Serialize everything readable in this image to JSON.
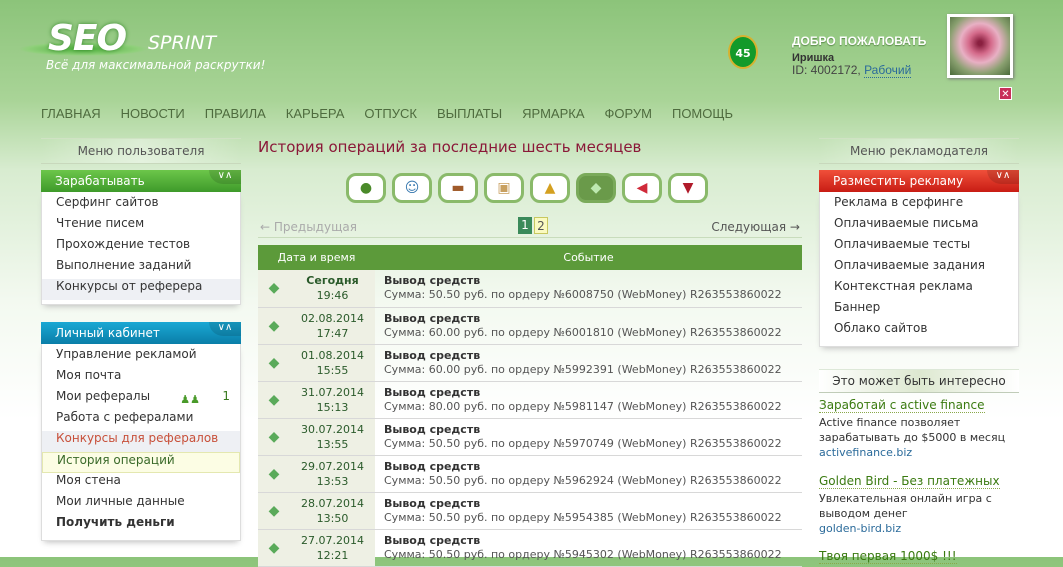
{
  "header": {
    "logo_main": "SEO",
    "logo_sub": "SPRINT",
    "slogan": "Всё для максимальной раскрутки!",
    "level": "45",
    "welcome": "ДОБРО ПОЖАЛОВАТЬ",
    "username": "Иришка",
    "id_label": "ID: 4002172,",
    "status": "Рабочий",
    "close": "✕"
  },
  "nav": [
    "ГЛАВНАЯ",
    "НОВОСТИ",
    "ПРАВИЛА",
    "КАРЬЕРА",
    "ОТПУСК",
    "ВЫПЛАТЫ",
    "ЯРМАРКА",
    "ФОРУМ",
    "ПОМОЩЬ"
  ],
  "left": {
    "title": "Меню пользователя",
    "earn": {
      "header": "Зарабатывать",
      "items": [
        "Серфинг сайтов",
        "Чтение писем",
        "Прохождение тестов",
        "Выполнение заданий",
        "Конкурсы от реферера"
      ]
    },
    "cabinet": {
      "header": "Личный кабинет",
      "items": [
        "Управление рекламой",
        "Моя почта",
        "Мои рефералы",
        "Работа с рефералами",
        "Конкурсы для рефералов",
        "История операций",
        "Моя стена",
        "Мои личные данные",
        "Получить деньги"
      ],
      "referrals_count": "1"
    }
  },
  "main": {
    "title": "История операций за последние шесть месяцев",
    "tabs": [
      "globe-icon",
      "user-icon",
      "wallet-icon",
      "shopping-bag-icon",
      "lock-edit-icon",
      "money-icon",
      "megaphone-icon",
      "wine-glass-icon"
    ],
    "pager": {
      "prev": "← Предыдущая",
      "next": "Следующая →",
      "pages": [
        "1",
        "2"
      ]
    },
    "columns": [
      "Дата и время",
      "Событие"
    ],
    "rows": [
      {
        "date": "Сегодня",
        "time": "19:46",
        "event": "Вывод средств",
        "details": "Сумма: 50.50 руб. по ордеру №6008750 (WebMoney) R263553860022"
      },
      {
        "date": "02.08.2014",
        "time": "17:47",
        "event": "Вывод средств",
        "details": "Сумма: 60.00 руб. по ордеру №6001810 (WebMoney) R263553860022"
      },
      {
        "date": "01.08.2014",
        "time": "15:55",
        "event": "Вывод средств",
        "details": "Сумма: 60.00 руб. по ордеру №5992391 (WebMoney) R263553860022"
      },
      {
        "date": "31.07.2014",
        "time": "15:13",
        "event": "Вывод средств",
        "details": "Сумма: 80.00 руб. по ордеру №5981147 (WebMoney) R263553860022"
      },
      {
        "date": "30.07.2014",
        "time": "13:55",
        "event": "Вывод средств",
        "details": "Сумма: 50.50 руб. по ордеру №5970749 (WebMoney) R263553860022"
      },
      {
        "date": "29.07.2014",
        "time": "13:53",
        "event": "Вывод средств",
        "details": "Сумма: 50.50 руб. по ордеру №5962924 (WebMoney) R263553860022"
      },
      {
        "date": "28.07.2014",
        "time": "13:50",
        "event": "Вывод средств",
        "details": "Сумма: 50.50 руб. по ордеру №5954385 (WebMoney) R263553860022"
      },
      {
        "date": "27.07.2014",
        "time": "12:21",
        "event": "Вывод средств",
        "details": "Сумма: 50.50 руб. по ордеру №5945302 (WebMoney) R263553860022"
      }
    ]
  },
  "right": {
    "title": "Меню рекламодателя",
    "advert": {
      "header": "Разместить рекламу",
      "items": [
        "Реклама в серфинге",
        "Оплачиваемые письма",
        "Оплачиваемые тесты",
        "Оплачиваемые задания",
        "Контекстная реклама",
        "Баннер",
        "Облако сайтов"
      ]
    },
    "interest_title": "Это может быть интересно",
    "ads": [
      {
        "title": "Заработай с active finance",
        "desc": "Active finance позволяет зарабатывать до $5000 в месяц",
        "url": "activefinance.biz"
      },
      {
        "title": "Golden Bird - Без платежных",
        "desc": "Увлекательная онлайн игра с выводом денег",
        "url": "golden-bird.biz"
      },
      {
        "title": "Твоя первая 1000$ !!!"
      }
    ]
  }
}
